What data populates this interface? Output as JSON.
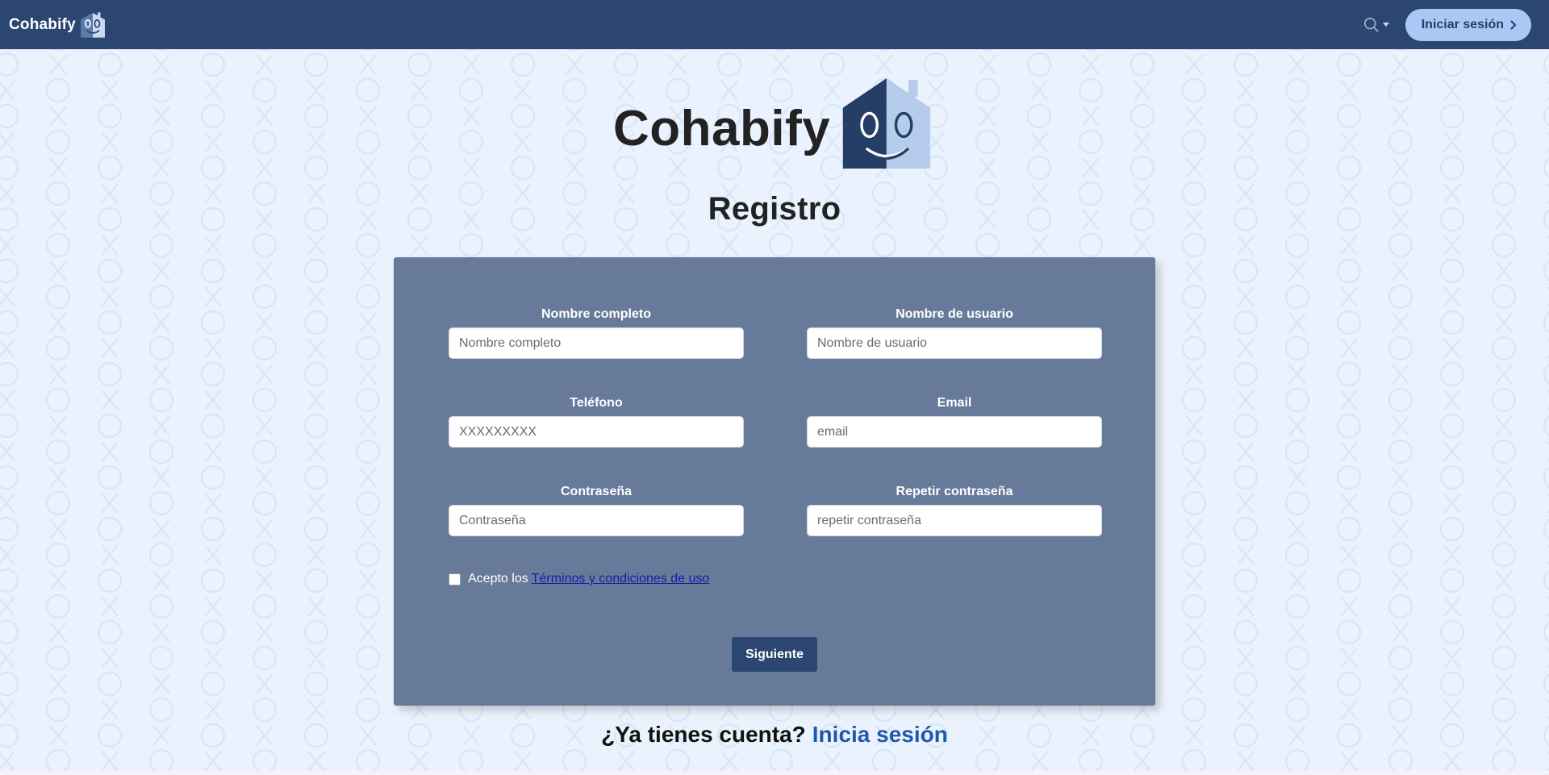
{
  "navbar": {
    "brand": "Cohabify",
    "login_button": "Iniciar sesión",
    "search_icon": "search-icon"
  },
  "header": {
    "logo_text": "Cohabify",
    "title": "Registro"
  },
  "form": {
    "full_name": {
      "label": "Nombre completo",
      "placeholder": "Nombre completo"
    },
    "username": {
      "label": "Nombre de usuario",
      "placeholder": "Nombre de usuario"
    },
    "phone": {
      "label": "Teléfono",
      "placeholder": "XXXXXXXXX"
    },
    "email": {
      "label": "Email",
      "placeholder": "email"
    },
    "password": {
      "label": "Contraseña",
      "placeholder": "Contraseña"
    },
    "repeat_password": {
      "label": "Repetir contraseña",
      "placeholder": "repetir contraseña"
    },
    "terms_prefix": "Acepto los",
    "terms_link": "Términos y condiciones de uso",
    "submit": "Siguiente"
  },
  "footer": {
    "question": "¿Ya tienes cuenta?",
    "signin_link": "Inicia sesión"
  },
  "colors": {
    "navbar": "#2b4671",
    "background": "#eaf3fd",
    "card": "#677a99",
    "login_button": "#a9c8f5",
    "link": "#1f5aa8"
  }
}
